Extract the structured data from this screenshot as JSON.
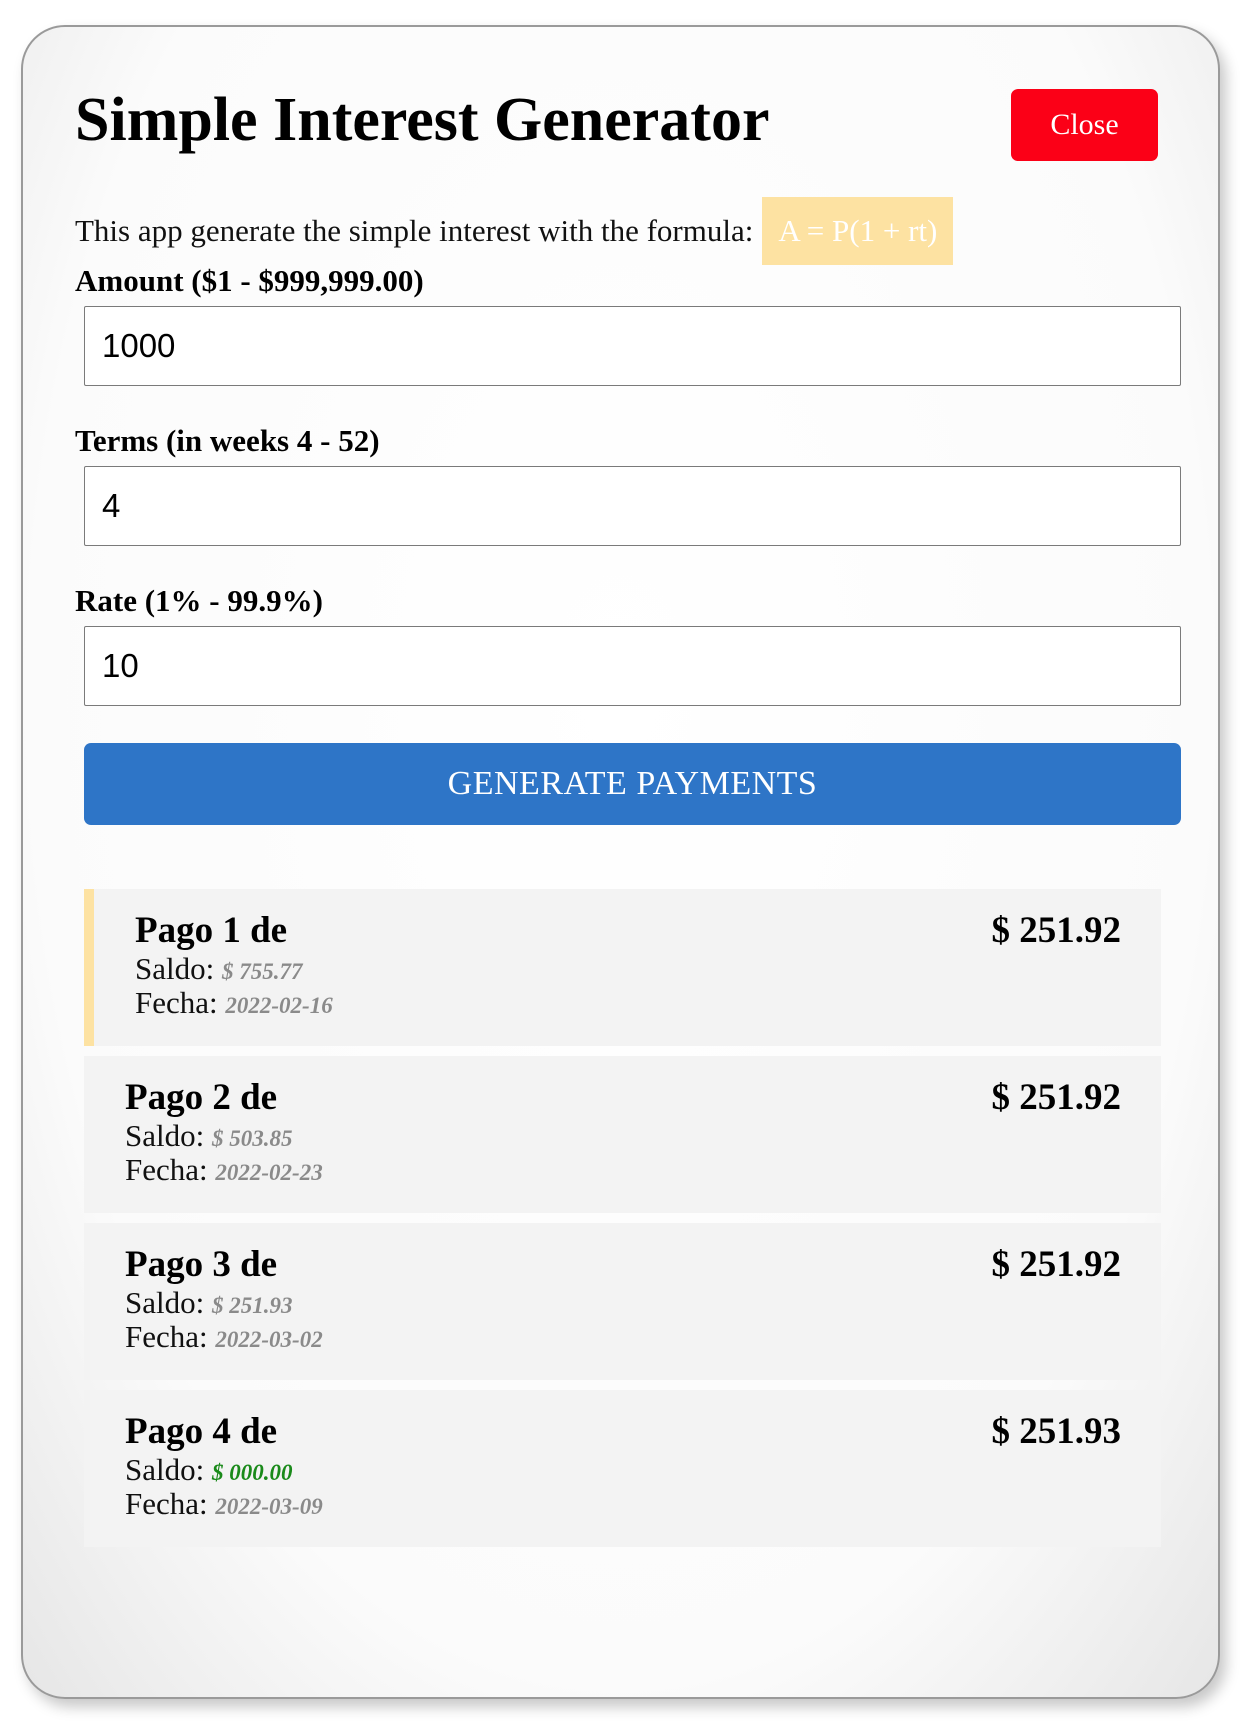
{
  "header": {
    "title": "Simple Interest Generator",
    "close_label": "Close"
  },
  "intro": {
    "text": "This app generate the simple interest with the formula:",
    "formula": "A = P(1 + rt)"
  },
  "form": {
    "amount": {
      "label": "Amount ($1 - $999,999.00)",
      "value": "1000"
    },
    "terms": {
      "label": "Terms (in weeks 4 - 52)",
      "value": "4"
    },
    "rate": {
      "label": "Rate (1% - 99.9%)",
      "value": "10"
    },
    "generate_label": "GENERATE PAYMENTS"
  },
  "payments": [
    {
      "title": "Pago 1 de",
      "amount": "$ 251.92",
      "saldo_label": "Saldo:",
      "saldo": "$ 755.77",
      "fecha_label": "Fecha:",
      "fecha": "2022-02-16"
    },
    {
      "title": "Pago 2 de",
      "amount": "$ 251.92",
      "saldo_label": "Saldo:",
      "saldo": "$ 503.85",
      "fecha_label": "Fecha:",
      "fecha": "2022-02-23"
    },
    {
      "title": "Pago 3 de",
      "amount": "$ 251.92",
      "saldo_label": "Saldo:",
      "saldo": "$ 251.93",
      "fecha_label": "Fecha:",
      "fecha": "2022-03-02"
    },
    {
      "title": "Pago 4 de",
      "amount": "$ 251.93",
      "saldo_label": "Saldo:",
      "saldo": "$ 000.00",
      "fecha_label": "Fecha:",
      "fecha": "2022-03-09"
    }
  ],
  "colors": {
    "close_button": "#fb0017",
    "generate_button": "#2e75c7",
    "formula_highlight": "#fde2a2",
    "active_payment_marker": "#fde2a2",
    "zero_balance": "#1a8a1a"
  }
}
